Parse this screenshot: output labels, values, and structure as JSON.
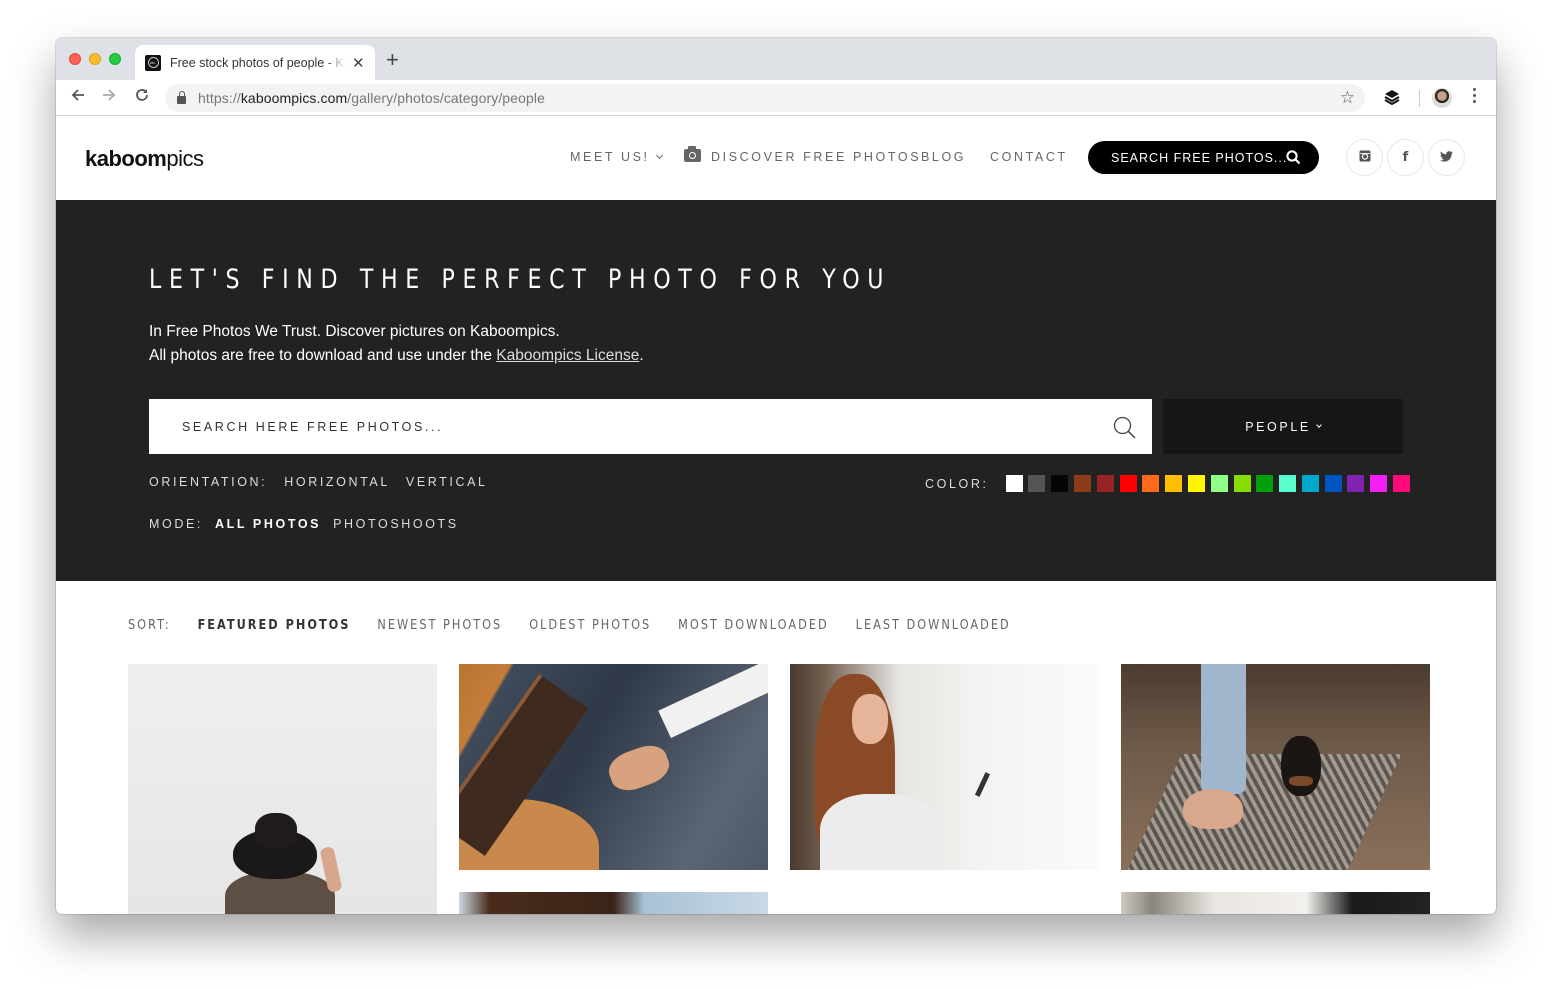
{
  "browser": {
    "tab": {
      "title": "Free stock photos of people - Kaboompics",
      "favicon": "kb-logo-icon"
    },
    "new_tab_label": "+",
    "url": {
      "scheme": "https://",
      "domain": "kaboompics.com",
      "path": "/gallery/photos/category/people"
    }
  },
  "header": {
    "logo_bold": "kaboom",
    "logo_light": "pics",
    "nav": [
      {
        "label": "MEET US!",
        "icon": "chevron-down-icon"
      },
      {
        "label": "DISCOVER FREE PHOTOS",
        "icon": "camera-icon"
      },
      {
        "label": "BLOG"
      },
      {
        "label": "CONTACT"
      }
    ],
    "search_label": "SEARCH FREE PHOTOS...",
    "social": [
      "instagram-icon",
      "facebook-icon",
      "twitter-icon"
    ]
  },
  "hero": {
    "title": "LET'S FIND THE PERFECT PHOTO FOR YOU",
    "line1": "In Free Photos We Trust. Discover pictures on Kaboompics.",
    "line2_prefix": "All photos are free to download and use under the ",
    "license_link": "Kaboompics License",
    "line2_suffix": ".",
    "search_placeholder": "SEARCH HERE FREE PHOTOS...",
    "category_selected": "PEOPLE",
    "orientation": {
      "label": "ORIENTATION:",
      "options": [
        "HORIZONTAL",
        "VERTICAL"
      ]
    },
    "mode": {
      "label": "MODE:",
      "options": [
        "ALL PHOTOS",
        "PHOTOSHOOTS"
      ],
      "active": "ALL PHOTOS"
    },
    "color": {
      "label": "COLOR:",
      "swatches": [
        "#ffffff",
        "#555555",
        "#050505",
        "#8b3a1a",
        "#962424",
        "#ff0000",
        "#ff6a1a",
        "#ffbf00",
        "#fff500",
        "#8fff85",
        "#88dd00",
        "#00a00d",
        "#58ffcc",
        "#00a8cc",
        "#0055c0",
        "#8222b0",
        "#f51ef5",
        "#ff0a7a"
      ]
    }
  },
  "sort": {
    "label": "SORT:",
    "options": [
      "FEATURED PHOTOS",
      "NEWEST PHOTOS",
      "OLDEST PHOTOS",
      "MOST DOWNLOADED",
      "LEAST DOWNLOADED"
    ],
    "active": "FEATURED PHOTOS"
  },
  "gallery": {
    "photos": [
      {
        "alt": "Person wearing black hat against white wall"
      },
      {
        "alt": "Person holding a leather notebook on their lap"
      },
      {
        "alt": "Smiling woman with phone by window curtains"
      },
      {
        "alt": "Barefoot person petting small dog on rug"
      },
      {
        "alt": "Photo partially visible"
      },
      {
        "alt": "Photo partially visible"
      },
      {
        "alt": "Photo partially visible"
      }
    ]
  }
}
